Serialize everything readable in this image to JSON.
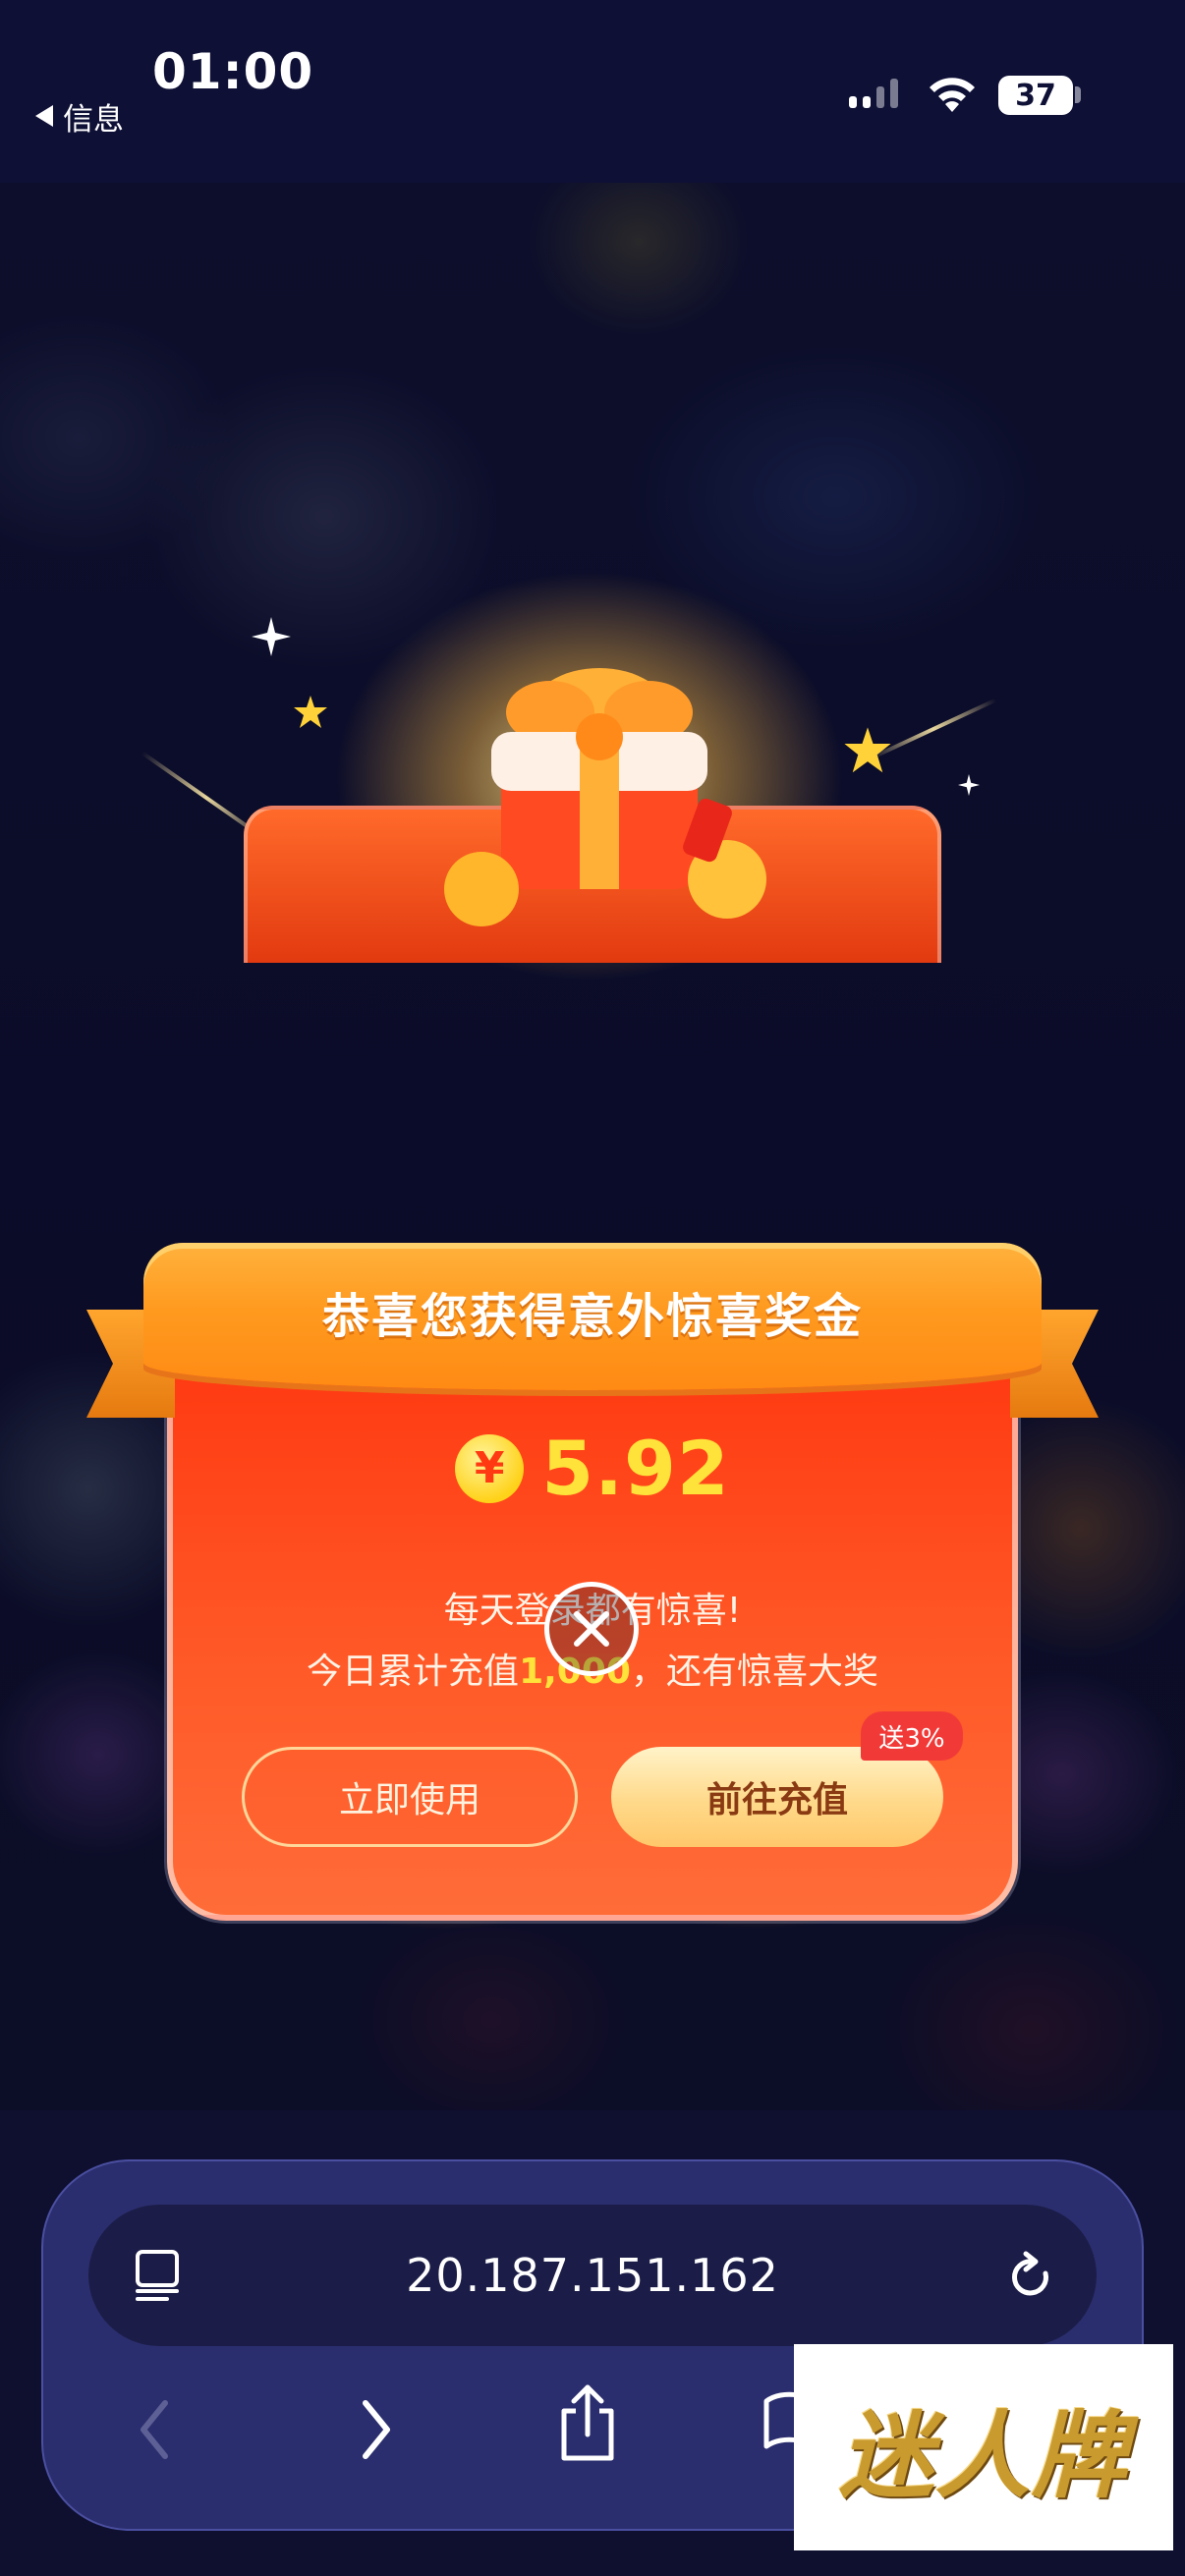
{
  "status_bar": {
    "back_label": "信息",
    "time": "01:00",
    "battery": "37"
  },
  "popup": {
    "title": "恭喜您获得意外惊喜奖金",
    "currency_symbol": "¥",
    "amount": "5.92",
    "line1": "每天登录都有惊喜!",
    "line2_prefix": "今日累计充值",
    "line2_highlight": "1,000",
    "line2_suffix": "，还有惊喜大奖",
    "use_button": "立即使用",
    "recharge_button": "前往充值",
    "recharge_badge": "送3%"
  },
  "browser": {
    "url": "20.187.151.162"
  },
  "watermark": {
    "text": "迷人牌"
  },
  "colors": {
    "background": "#0f1030",
    "panel_red": "#ff3a12",
    "ribbon_orange": "#ff9a1f",
    "amount_yellow": "#ffe23a",
    "badge_red": "#f13a38",
    "chrome_panel": "#2b2e6e"
  },
  "icons": {
    "back": "back-triangle-icon",
    "signal": "cellular-signal-icon",
    "wifi": "wifi-icon",
    "battery": "battery-icon",
    "coin": "yuan-coin-icon",
    "close": "close-icon",
    "tabs": "tabs-icon",
    "reload": "reload-icon",
    "back_nav": "chevron-left-icon",
    "forward_nav": "chevron-right-icon",
    "share": "share-icon",
    "bookmarks": "book-icon"
  }
}
